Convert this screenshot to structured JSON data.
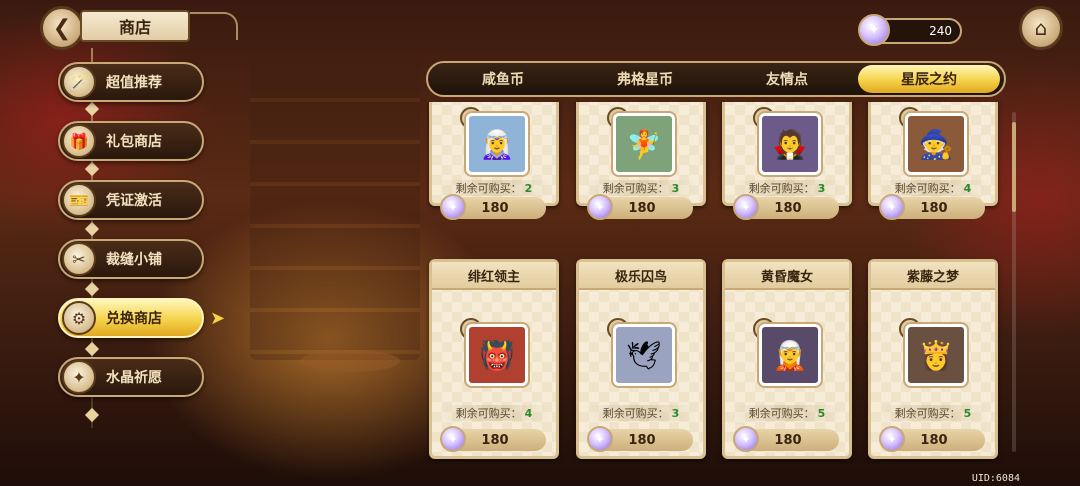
{
  "header": {
    "title": "商店"
  },
  "currency": {
    "amount": "240"
  },
  "sidebar": {
    "items": [
      {
        "label": "超值推荐",
        "icon": "🪄"
      },
      {
        "label": "礼包商店",
        "icon": "🎁"
      },
      {
        "label": "凭证激活",
        "icon": "🎫"
      },
      {
        "label": "裁缝小铺",
        "icon": "✂"
      },
      {
        "label": "兑换商店",
        "icon": "⚙"
      },
      {
        "label": "水晶祈愿",
        "icon": "✦"
      }
    ],
    "active_index": 4
  },
  "tabs": [
    {
      "label": "咸鱼币"
    },
    {
      "label": "弗格星币"
    },
    {
      "label": "友情点"
    },
    {
      "label": "星辰之约"
    }
  ],
  "cards": [
    {
      "name": "",
      "remain_label": "剩余可购买：",
      "remain": "2",
      "price": "180",
      "face": "🧝‍♀️",
      "bg": "#8fb4d8"
    },
    {
      "name": "",
      "remain_label": "剩余可购买：",
      "remain": "3",
      "price": "180",
      "face": "🧚",
      "bg": "#7ea27a"
    },
    {
      "name": "",
      "remain_label": "剩余可购买：",
      "remain": "3",
      "price": "180",
      "face": "🧛",
      "bg": "#6b5a8a"
    },
    {
      "name": "",
      "remain_label": "剩余可购买：",
      "remain": "4",
      "price": "180",
      "face": "🧙",
      "bg": "#8a5a3a"
    },
    {
      "name": "绯红领主",
      "remain_label": "剩余可购买：",
      "remain": "4",
      "price": "180",
      "face": "👹",
      "bg": "#b04030"
    },
    {
      "name": "极乐囚鸟",
      "remain_label": "剩余可购买：",
      "remain": "3",
      "price": "180",
      "face": "🕊",
      "bg": "#9aa4c0"
    },
    {
      "name": "黄昏魔女",
      "remain_label": "剩余可购买：",
      "remain": "5",
      "price": "180",
      "face": "🧝",
      "bg": "#5a4a6a"
    },
    {
      "name": "紫藤之梦",
      "remain_label": "剩余可购买：",
      "remain": "5",
      "price": "180",
      "face": "👸",
      "bg": "#6a5040"
    }
  ],
  "footer": {
    "uid": "UID:6084"
  }
}
